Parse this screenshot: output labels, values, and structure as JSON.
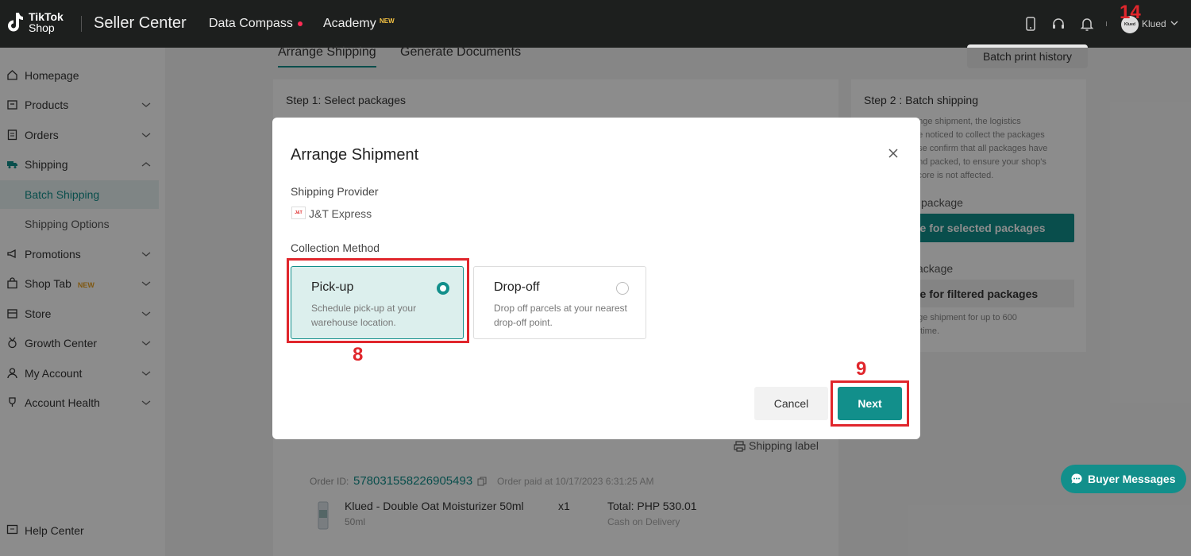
{
  "topbar": {
    "logo_line1": "TikTok",
    "logo_line2": "Shop",
    "seller_center": "Seller Center",
    "nav_data_compass": "Data Compass",
    "nav_academy": "Academy",
    "nav_academy_badge": "NEW",
    "user_avatar": "Klued",
    "user_name": "Klued"
  },
  "sidebar": {
    "items": [
      {
        "label": "Homepage"
      },
      {
        "label": "Products"
      },
      {
        "label": "Orders"
      },
      {
        "label": "Shipping"
      },
      {
        "label": "Batch Shipping"
      },
      {
        "label": "Shipping Options"
      },
      {
        "label": "Promotions"
      },
      {
        "label": "Shop Tab",
        "badge": "NEW"
      },
      {
        "label": "Store"
      },
      {
        "label": "Growth Center"
      },
      {
        "label": "My Account"
      },
      {
        "label": "Account Health"
      }
    ],
    "help_center": "Help Center"
  },
  "page": {
    "tabs": [
      "Arrange Shipping",
      "Generate Documents"
    ],
    "batch_print_history": "Batch print history",
    "step1_title": "Step 1: Select packages",
    "step2_title": "Step 2 : Batch shipping",
    "step2_desc": [
      "ange shipment, the logistics",
      "be noticed to collect the packages",
      "ase confirm that all packages have",
      "and packed, to ensure your shop's",
      "score is not affected."
    ],
    "selected_label": "package",
    "selected_button": "ge for selected packages",
    "filtered_label": "ackage",
    "filtered_button": "ge for filtered packages",
    "filtered_desc": [
      "nge shipment for up to 600",
      "a time."
    ],
    "shipping_label": "Shipping label",
    "order": {
      "id_label": "Order ID:",
      "id": "578031558226905493",
      "paid": "Order paid at 10/17/2023 6:31:25 AM",
      "product_name": "Klued - Double Oat Moisturizer 50ml",
      "variant": "50ml",
      "qty": "x1",
      "total": "Total: PHP 530.01",
      "payment": "Cash on Delivery"
    },
    "buyer_messages": "Buyer Messages"
  },
  "modal": {
    "title": "Arrange Shipment",
    "shipping_provider_label": "Shipping Provider",
    "provider_logo": "J&T",
    "provider_name": "J&T Express",
    "collection_method_label": "Collection Method",
    "options": [
      {
        "title": "Pick-up",
        "desc": "Schedule pick-up at your warehouse location.",
        "selected": true
      },
      {
        "title": "Drop-off",
        "desc": "Drop off parcels at your nearest drop-off point.",
        "selected": false
      }
    ],
    "cancel": "Cancel",
    "next": "Next"
  },
  "annotations": {
    "a14": "14",
    "a8": "8",
    "a9": "9",
    "color": "#e0262c"
  },
  "colors": {
    "accent": "#128f8b",
    "topbar": "#1d1f1e"
  }
}
